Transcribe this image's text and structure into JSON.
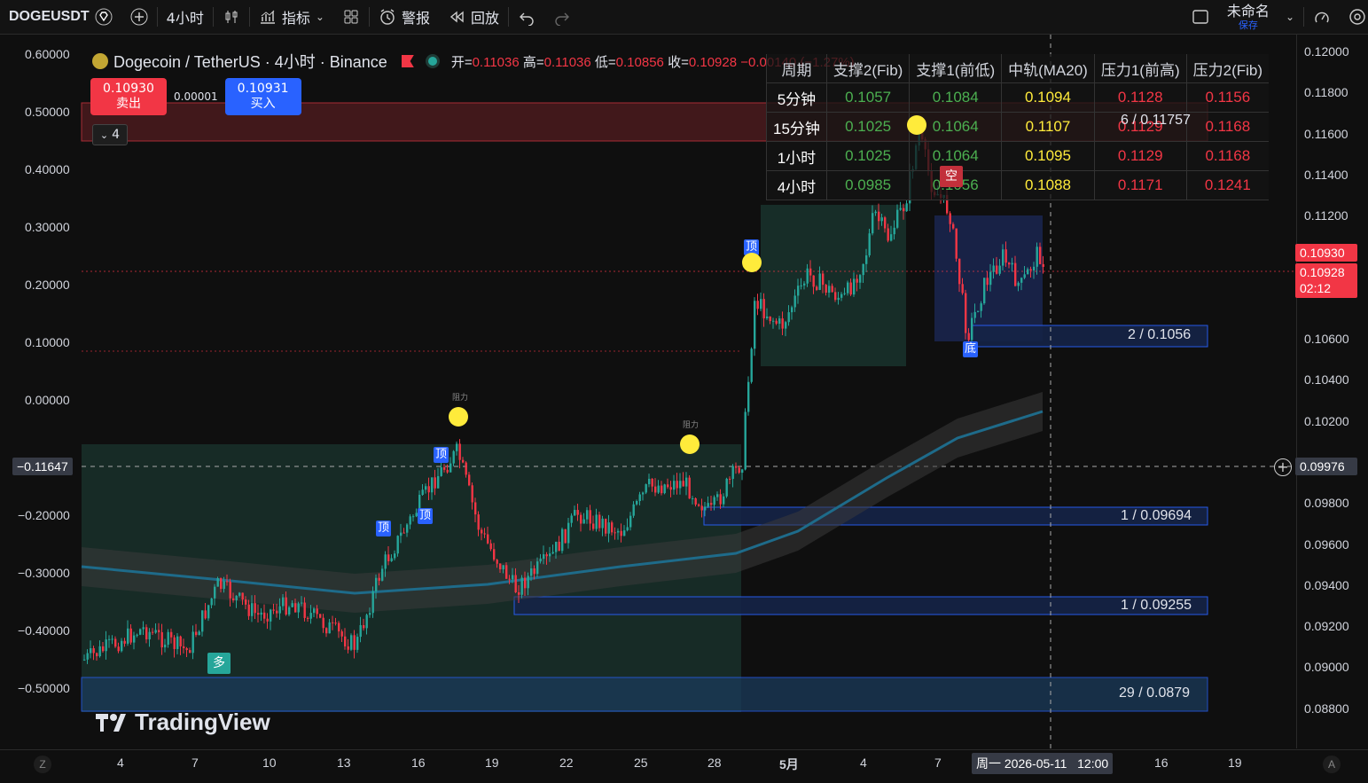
{
  "toolbar": {
    "symbol": "DOGEUSDT",
    "interval": "4小时",
    "indicators_label": "指标",
    "alert_label": "警报",
    "replay_label": "回放",
    "layout_name": "未命名",
    "save_label": "保存"
  },
  "legend": {
    "title": "Dogecoin / TetherUS · 4小时 · Binance",
    "open_label": "开=",
    "open": "0.11036",
    "high_label": "高=",
    "high": "0.11036",
    "low_label": "低=",
    "low": "0.10856",
    "close_label": "收=",
    "close": "0.10928",
    "change": "−0.00140 (−1.27%)"
  },
  "trade": {
    "sell_price": "0.10930",
    "sell_label": "卖出",
    "spread": "0.00001",
    "buy_price": "0.10931",
    "buy_label": "买入",
    "collapse_count": "4"
  },
  "levels_table": {
    "headers": [
      "周期",
      "支撑2(Fib)",
      "支撑1(前低)",
      "中轨(MA20)",
      "压力1(前高)",
      "压力2(Fib)"
    ],
    "rows": [
      {
        "period": "5分钟",
        "s2": "0.1057",
        "s1": "0.1084",
        "mid": "0.1094",
        "r1": "0.1128",
        "r2": "0.1156"
      },
      {
        "period": "15分钟",
        "s2": "0.1025",
        "s1": "0.1064",
        "mid": "0.1107",
        "r1": "0.1129",
        "r2": "0.1168"
      },
      {
        "period": "1小时",
        "s2": "0.1025",
        "s1": "0.1064",
        "mid": "0.1095",
        "r1": "0.1129",
        "r2": "0.1168"
      },
      {
        "period": "4小时",
        "s2": "0.0985",
        "s1": "0.1056",
        "mid": "0.1088",
        "r1": "0.1171",
        "r2": "0.1241"
      }
    ]
  },
  "left_axis": [
    "0.60000",
    "0.50000",
    "0.40000",
    "0.30000",
    "0.20000",
    "0.10000",
    "0.00000",
    "−0.20000",
    "−0.30000",
    "−0.40000",
    "−0.50000"
  ],
  "left_cursor": "−0.11647",
  "right_axis": [
    "0.12000",
    "0.11800",
    "0.11600",
    "0.11400",
    "0.11200",
    "0.10600",
    "0.10400",
    "0.10200",
    "0.09800",
    "0.09600",
    "0.09400",
    "0.09200",
    "0.09000",
    "0.08800"
  ],
  "price_tags": {
    "current": "0.10930",
    "last": "0.10928",
    "countdown": "02:12",
    "cursor": "0.09976"
  },
  "time_axis": [
    "4",
    "7",
    "10",
    "13",
    "16",
    "19",
    "22",
    "25",
    "28",
    "5月",
    "4",
    "7",
    "16",
    "19"
  ],
  "time_cursor": "周一 2026-05-11   12:00",
  "zones": {
    "z1": "2 / 0.1056",
    "z2": "1 / 0.09694",
    "z3": "1 / 0.09255",
    "z4": "29 / 0.0879",
    "overlap": "6 / 0.11757"
  },
  "badges": {
    "top": "顶",
    "bottom": "底",
    "short": "空",
    "long": "多",
    "tiny": "阻力"
  },
  "brand": "TradingView",
  "axis_corner_left": "Z",
  "axis_corner_right": "A",
  "colors": {
    "up": "#26a69a",
    "down": "#f23645",
    "accent": "#2962ff",
    "mid": "#ffeb3b"
  }
}
